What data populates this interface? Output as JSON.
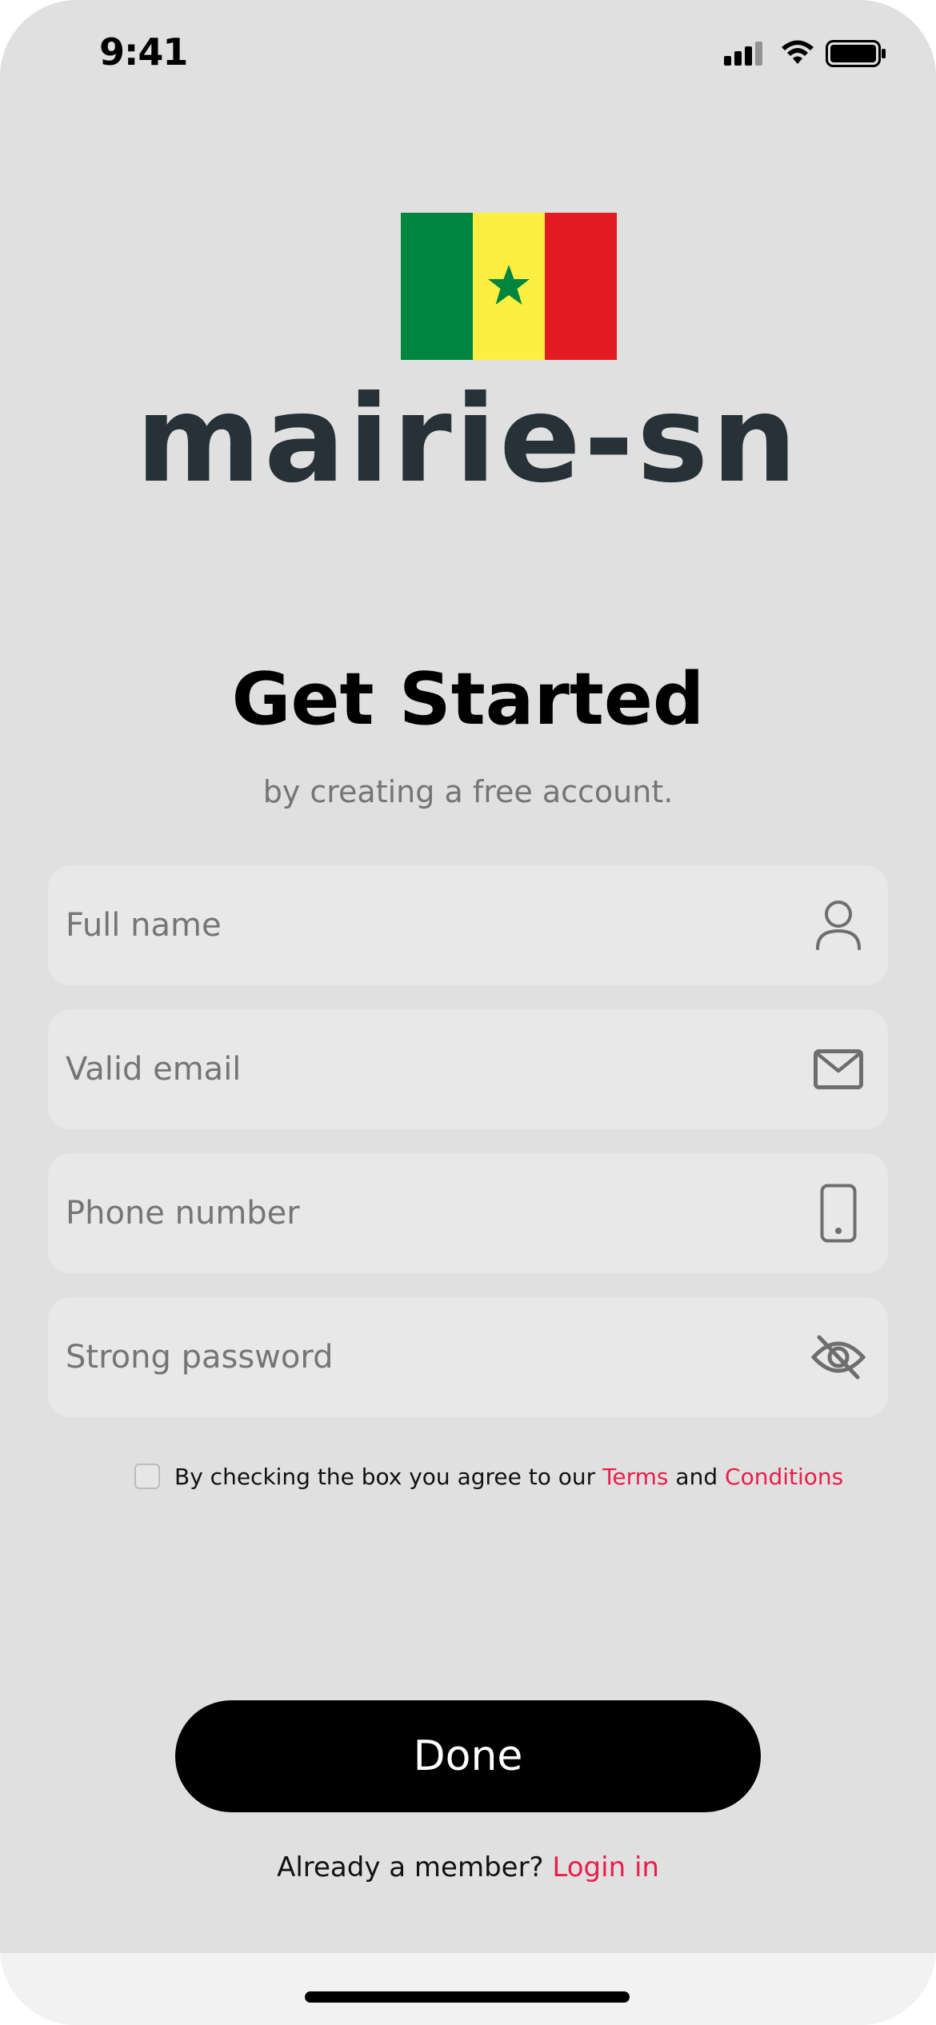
{
  "status_bar": {
    "time": "9:41"
  },
  "brand": {
    "name": "mairie-sn"
  },
  "header": {
    "title": "Get Started",
    "subtitle": "by creating a free account."
  },
  "form": {
    "full_name_placeholder": "Full name",
    "email_placeholder": "Valid email",
    "phone_placeholder": "Phone number",
    "password_placeholder": "Strong password"
  },
  "terms": {
    "prefix": "By checking the box you agree to our ",
    "terms_link": "Terms",
    "and": " and ",
    "conditions_link": "Conditions"
  },
  "actions": {
    "done_label": "Done"
  },
  "footer_text": {
    "prompt": "Already a member? ",
    "login_link": "Login in"
  },
  "colors": {
    "accent": "#e91e4a",
    "background": "#e0e0e0",
    "field": "#e8e8e8",
    "brand_text": "#263238"
  },
  "icons": [
    "signal-icon",
    "wifi-icon",
    "battery-icon",
    "user-icon",
    "mail-icon",
    "phone-icon",
    "eye-off-icon"
  ]
}
